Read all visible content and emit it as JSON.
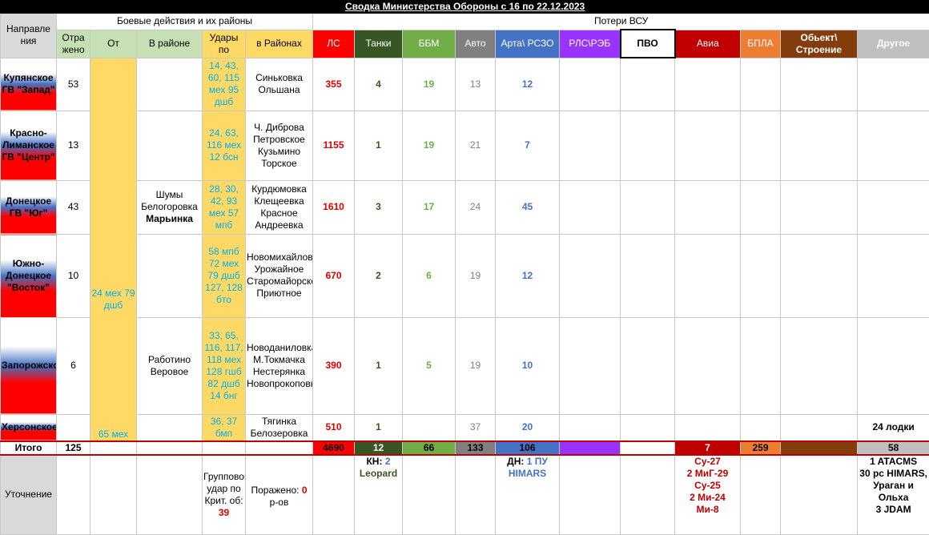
{
  "title": "Сводка Министерства Обороны с 16 по 22.12.2023",
  "header": {
    "group_combat": "Боевые действия и их районы",
    "group_losses": "Потери ВСУ",
    "direction": "Направле ния",
    "repelled": "Отра жено",
    "from": "От",
    "in_area": "В районе",
    "strikes": "Удары по",
    "in_areas": "в Районах",
    "ls": "ЛС",
    "tanks": "Танки",
    "bbm": "ББМ",
    "auto": "Авто",
    "arta": "Арта\\ РСЗО",
    "rls": "РЛС\\РЭБ",
    "pvo": "ПВО",
    "avia": "Авиа",
    "bpla": "БПЛА",
    "object": "Обьект\\ Строение",
    "other": "Другое"
  },
  "colors": {
    "ls": "#ff0000",
    "tanks": "#375623",
    "bbm": "#70ad47",
    "auto": "#808080",
    "arta": "#4472c4",
    "rls": "#9933ff",
    "pvo": "#ffffff",
    "avia": "#c00000",
    "bpla": "#ed7d31",
    "object": "#843c0c",
    "other": "#bfbfbf"
  },
  "from_merged": "24 мех 79 дшб",
  "area_merged": "Шумы Белогоровка",
  "area_merged_bold": "Марьинка",
  "from_zap": "65 мех",
  "area_zap": "Работино Веровое",
  "rows": [
    {
      "dir": "Купянское ГВ \"Запад\"",
      "rep": "53",
      "strikes": "14, 43, 60, 115 мех 95 дшб",
      "areas": "Синьковка Ольшана",
      "ls": "355",
      "tanks": "4",
      "bbm": "19",
      "auto": "13",
      "arta": "12",
      "other": ""
    },
    {
      "dir": "Красно-Лиманское ГВ \"Центр\"",
      "rep": "13",
      "strikes": "24, 63, 116 мех 12 бсн",
      "areas": "Ч. Диброва Петровское Кузьмино Торское",
      "ls": "1155",
      "tanks": "1",
      "bbm": "19",
      "auto": "21",
      "arta": "7",
      "other": ""
    },
    {
      "dir": "Донецкое ГВ \"Юг\"",
      "rep": "43",
      "strikes": "28, 30, 42, 93 мех 57 мпб",
      "areas": "Курдюмовка Клещеевка Красное Андреевка",
      "ls": "1610",
      "tanks": "3",
      "bbm": "17",
      "auto": "24",
      "arta": "45",
      "other": ""
    },
    {
      "dir": "Южно-Донецкое \"Восток\"",
      "rep": "10",
      "strikes": "58 мпб 72 мех 79 дшб 127, 128 бто",
      "areas": "Новомихайловка Урожайное Старомайорское Приютное",
      "ls": "670",
      "tanks": "2",
      "bbm": "6",
      "auto": "19",
      "arta": "12",
      "other": ""
    },
    {
      "dir": "Запорожское",
      "rep": "6",
      "strikes": "33, 65, 116, 117, 118 мех 128 гшб 82 дшб 14 бнг",
      "areas": "Новоданиловка М.Токмачка Нестерянка Новопрокоповка",
      "ls": "390",
      "tanks": "1",
      "bbm": "5",
      "auto": "19",
      "arta": "10",
      "other": ""
    },
    {
      "dir": "Херсонское",
      "rep": "",
      "strikes": "36, 37 бмп",
      "areas": "Тягинка Белозеровка",
      "ls": "510",
      "tanks": "1",
      "bbm": "",
      "auto": "37",
      "arta": "20",
      "other": "24 лодки"
    }
  ],
  "totals": {
    "label": "Итого",
    "rep": "125",
    "ls": "4690",
    "tanks": "12",
    "bbm": "66",
    "auto": "133",
    "arta": "106",
    "avia": "7",
    "bpla": "259",
    "other": "58"
  },
  "clarify": {
    "label": "Уточнение",
    "group_strike": "Групповой удар по Крит. об:",
    "group_strike_num": "39",
    "hit": "Поражено:",
    "hit_num": "0",
    "hit_suffix": "р-ов",
    "tanks_prefix": "КН:",
    "tanks_num": "2",
    "tanks_name": "Leopard",
    "arta_prefix": "ДН:",
    "arta_val": "1 ПУ HIMARS",
    "avia": [
      "Су-27",
      "2 МиГ-29",
      "Су-25",
      "2 Ми-24",
      "Ми-8"
    ],
    "other": [
      "1 ATACMS",
      "30 рс HIMARS,",
      "Ураган и Ольха",
      "3 JDAM"
    ]
  }
}
